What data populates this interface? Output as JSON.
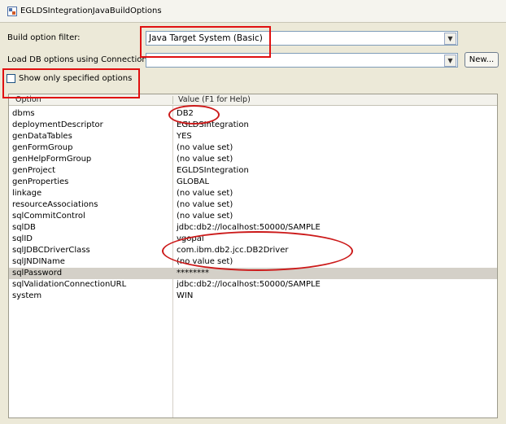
{
  "window": {
    "title": "EGLDSIntegrationJavaBuildOptions"
  },
  "filter": {
    "label": "Build option filter:",
    "value": "Java Target System (Basic)"
  },
  "connection": {
    "label": "Load DB options using Connection:",
    "value": "",
    "new_label": "New..."
  },
  "show_only": {
    "label": "Show only specified options",
    "checked": false
  },
  "table": {
    "columns": [
      "Option",
      "Value (F1 for Help)"
    ],
    "rows": [
      {
        "option": "dbms",
        "value": "DB2"
      },
      {
        "option": "deploymentDescriptor",
        "value": "EGLDSIntegration"
      },
      {
        "option": "genDataTables",
        "value": "YES"
      },
      {
        "option": "genFormGroup",
        "value": "(no value set)"
      },
      {
        "option": "genHelpFormGroup",
        "value": "(no value set)"
      },
      {
        "option": "genProject",
        "value": "EGLDSIntegration"
      },
      {
        "option": "genProperties",
        "value": "GLOBAL"
      },
      {
        "option": "linkage",
        "value": "(no value set)"
      },
      {
        "option": "resourceAssociations",
        "value": "(no value set)"
      },
      {
        "option": "sqlCommitControl",
        "value": "(no value set)"
      },
      {
        "option": "sqlDB",
        "value": "jdbc:db2://localhost:50000/SAMPLE"
      },
      {
        "option": "sqlID",
        "value": "vgopal"
      },
      {
        "option": "sqlJDBCDriverClass",
        "value": "com.ibm.db2.jcc.DB2Driver"
      },
      {
        "option": "sqlJNDIName",
        "value": "(no value set)"
      },
      {
        "option": "sqlPassword",
        "value": "********"
      },
      {
        "option": "sqlValidationConnectionURL",
        "value": "jdbc:db2://localhost:50000/SAMPLE"
      },
      {
        "option": "system",
        "value": "WIN"
      }
    ],
    "selected_row": "sqlPassword"
  },
  "annotations": {
    "color": "#e01010"
  }
}
